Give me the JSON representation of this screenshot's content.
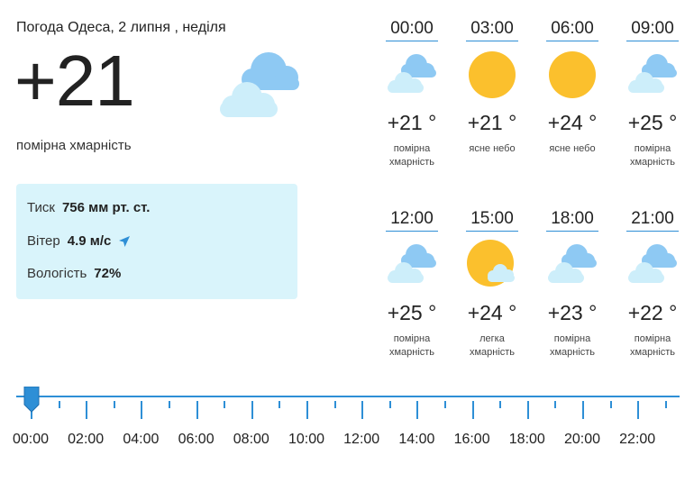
{
  "header": {
    "title": "Погода Одеса, 2 липня , неділя",
    "temperature": "+21",
    "condition": "помірна хмарність",
    "icon": "cloud-icon"
  },
  "details": {
    "pressure_label": "Тиск",
    "pressure_value": "756 мм рт. ст.",
    "wind_label": "Вітер",
    "wind_value": "4.9 м/с",
    "wind_icon": "wind-direction-arrow-icon",
    "humidity_label": "Вологість",
    "humidity_value": "72%"
  },
  "forecast": [
    {
      "time": "00:00",
      "temp": "+21 °",
      "desc": "помірна хмарність",
      "icon": "cloud-icon"
    },
    {
      "time": "03:00",
      "temp": "+21 °",
      "desc": "ясне небо",
      "icon": "sun-icon"
    },
    {
      "time": "06:00",
      "temp": "+24 °",
      "desc": "ясне небо",
      "icon": "sun-icon"
    },
    {
      "time": "09:00",
      "temp": "+25 °",
      "desc": "помірна хмарність",
      "icon": "cloud-icon"
    },
    {
      "time": "12:00",
      "temp": "+25 °",
      "desc": "помірна хмарність",
      "icon": "cloud-icon"
    },
    {
      "time": "15:00",
      "temp": "+24 °",
      "desc": "легка хмарність",
      "icon": "sun-cloud-icon"
    },
    {
      "time": "18:00",
      "temp": "+23 °",
      "desc": "помірна хмарність",
      "icon": "cloud-icon"
    },
    {
      "time": "21:00",
      "temp": "+22 °",
      "desc": "помірна хмарність",
      "icon": "cloud-icon"
    }
  ],
  "timeline": {
    "labels": [
      "00:00",
      "02:00",
      "04:00",
      "06:00",
      "08:00",
      "10:00",
      "12:00",
      "14:00",
      "16:00",
      "18:00",
      "20:00",
      "22:00"
    ],
    "selected_hour": 0
  },
  "colors": {
    "accent": "#2e8fd6",
    "info_bg": "#d9f4fb",
    "cloud_dark": "#8ec9f3",
    "cloud_light": "#cdeefa",
    "sun": "#fbc02d"
  }
}
